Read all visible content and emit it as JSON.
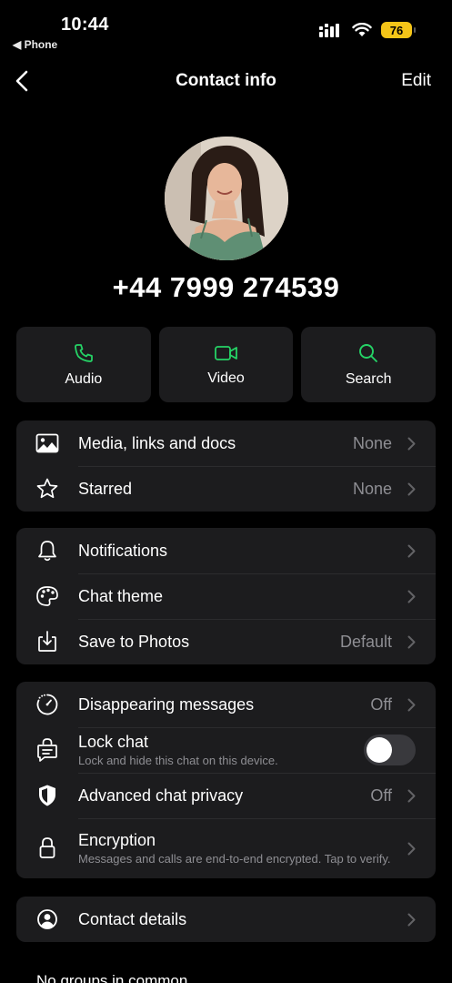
{
  "status_bar": {
    "time": "10:44",
    "back_app": "◀ Phone",
    "battery": "76"
  },
  "nav": {
    "title": "Contact info",
    "edit": "Edit"
  },
  "contact": {
    "phone": "+44 7999 274539"
  },
  "actions": [
    {
      "label": "Audio",
      "icon": "phone-icon"
    },
    {
      "label": "Video",
      "icon": "video-icon"
    },
    {
      "label": "Search",
      "icon": "search-icon"
    }
  ],
  "group1": [
    {
      "label": "Media, links and docs",
      "value": "None",
      "icon": "image-icon"
    },
    {
      "label": "Starred",
      "value": "None",
      "icon": "star-icon"
    }
  ],
  "group2": [
    {
      "label": "Notifications",
      "value": "",
      "icon": "bell-icon"
    },
    {
      "label": "Chat theme",
      "value": "",
      "icon": "palette-icon"
    },
    {
      "label": "Save to Photos",
      "value": "Default",
      "icon": "download-icon"
    }
  ],
  "group3": [
    {
      "label": "Disappearing messages",
      "value": "Off",
      "icon": "timer-icon"
    },
    {
      "label": "Lock chat",
      "sub": "Lock and hide this chat on this device.",
      "toggle": false,
      "icon": "chat-lock-icon"
    },
    {
      "label": "Advanced chat privacy",
      "value": "Off",
      "icon": "shield-icon"
    },
    {
      "label": "Encryption",
      "sub": "Messages and calls are end-to-end encrypted. Tap to verify.",
      "icon": "lock-icon"
    }
  ],
  "group4": [
    {
      "label": "Contact details",
      "icon": "person-icon"
    }
  ],
  "footer": "No groups in common",
  "colors": {
    "accent": "#25d366",
    "background": "#000000",
    "card": "#1c1c1e",
    "secondary_text": "#8e8e93",
    "battery": "#f5c518"
  }
}
